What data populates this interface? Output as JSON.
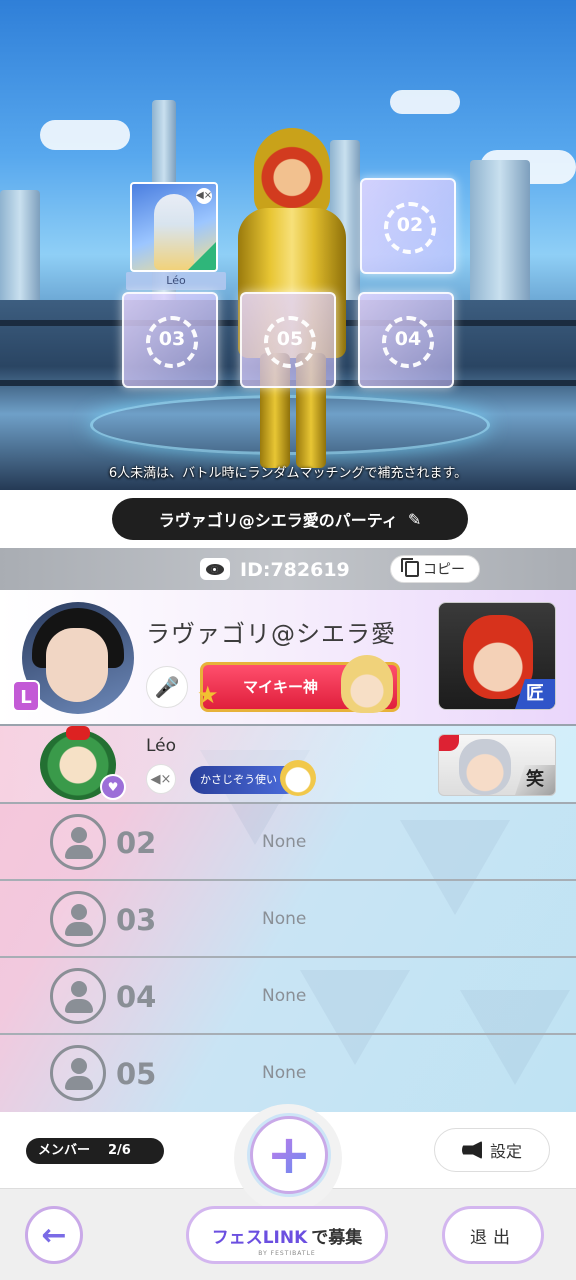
{
  "scene": {
    "hint": "6人未満は、バトル時にランダムマッチングで補充されます。",
    "slots": [
      "02",
      "03",
      "05",
      "04"
    ],
    "occupied_card_name": "Léo"
  },
  "party": {
    "name": "ラヴァゴリ@シエラ愛のパーティ",
    "id_text": "ID:782619",
    "copy_label": "コピー"
  },
  "members": {
    "leader": {
      "badge": "L",
      "name": "ラヴァゴリ@シエラ愛",
      "title": "マイキー神",
      "rank": "匠"
    },
    "second": {
      "name": "Léo",
      "title": "かさじぞう使い",
      "rank": "笑"
    },
    "empty": [
      {
        "number": "02",
        "status": "None"
      },
      {
        "number": "03",
        "status": "None"
      },
      {
        "number": "04",
        "status": "None"
      },
      {
        "number": "05",
        "status": "None"
      }
    ]
  },
  "footer": {
    "member_label": "メンバー",
    "member_count": "2/6",
    "settings_label": "設定",
    "recruit_logo": "フェスLINK",
    "recruit_label": "で募集",
    "recruit_sub": "BY FESTIBATLE",
    "leave_label": "退出"
  },
  "colors": {
    "accent_purple": "#c9a9e8",
    "accent_blue": "#4b7ef0",
    "title_red": "#e01f3c"
  }
}
